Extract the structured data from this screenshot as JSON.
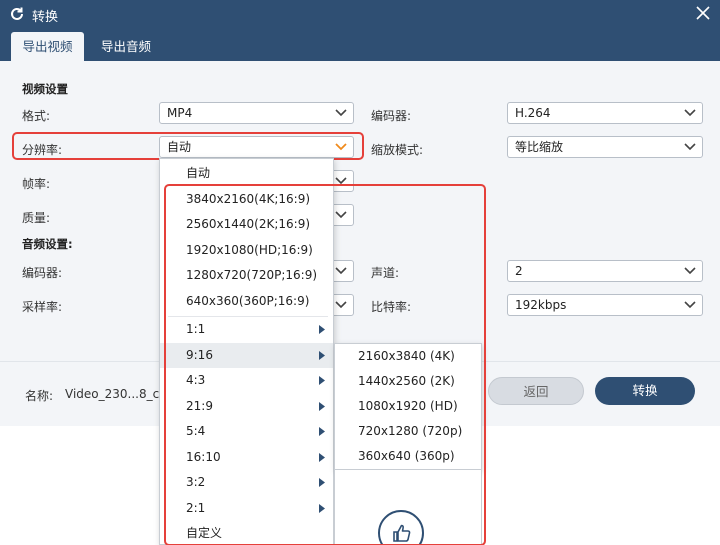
{
  "window": {
    "title": "转换"
  },
  "tabs": [
    {
      "label": "导出视频"
    },
    {
      "label": "导出音频"
    }
  ],
  "video_settings": {
    "section_title": "视频设置",
    "format": {
      "label": "格式:",
      "value": "MP4"
    },
    "encoder": {
      "label": "编码器:",
      "value": "H.264"
    },
    "resolution": {
      "label": "分辨率:",
      "value": "自动"
    },
    "zoom_mode": {
      "label": "缩放模式:",
      "value": "等比缩放"
    },
    "frame_rate": {
      "label": "帧率:"
    },
    "quality": {
      "label": "质量:"
    }
  },
  "audio_settings": {
    "section_title": "音频设置:",
    "encoder": {
      "label": "编码器:"
    },
    "channel": {
      "label": "声道:",
      "value": "2"
    },
    "sample_rate": {
      "label": "采样率:"
    },
    "bitrate": {
      "label": "比特率:",
      "value": "192kbps"
    }
  },
  "footer": {
    "name_label": "名称:",
    "name_value": "Video_230...8_c",
    "back_label": "返回",
    "convert_label": "转换"
  },
  "resolution_dropdown": {
    "items": [
      {
        "label": "自动"
      },
      {
        "label": "3840x2160(4K;16:9)"
      },
      {
        "label": "2560x1440(2K;16:9)"
      },
      {
        "label": "1920x1080(HD;16:9)"
      },
      {
        "label": "1280x720(720P;16:9)"
      },
      {
        "label": "640x360(360P;16:9)"
      }
    ],
    "ratio_items": [
      {
        "label": "1:1",
        "has_submenu": true
      },
      {
        "label": "9:16",
        "has_submenu": true,
        "highlighted": true
      },
      {
        "label": "4:3",
        "has_submenu": true
      },
      {
        "label": "21:9",
        "has_submenu": true
      },
      {
        "label": "5:4",
        "has_submenu": true
      },
      {
        "label": "16:10",
        "has_submenu": true
      },
      {
        "label": "3:2",
        "has_submenu": true
      },
      {
        "label": "2:1",
        "has_submenu": true
      },
      {
        "label": "自定义",
        "has_submenu": false
      }
    ]
  },
  "submenu_9_16": {
    "items": [
      {
        "label": "2160x3840 (4K)"
      },
      {
        "label": "1440x2560 (2K)"
      },
      {
        "label": "1080x1920 (HD)"
      },
      {
        "label": "720x1280 (720p)"
      },
      {
        "label": "360x640 (360p)"
      }
    ]
  },
  "icons": {
    "title": "refresh-icon",
    "close": "close-icon",
    "dropdown": "chevron-down-icon",
    "submenu": "chevron-right-icon",
    "feedback": "thumbs-up-icon"
  },
  "colors": {
    "titlebar": "#2f4f73",
    "highlight_border": "#e5403a",
    "active_chevron": "#f08a1c",
    "body_bg": "#f3f5f8"
  }
}
